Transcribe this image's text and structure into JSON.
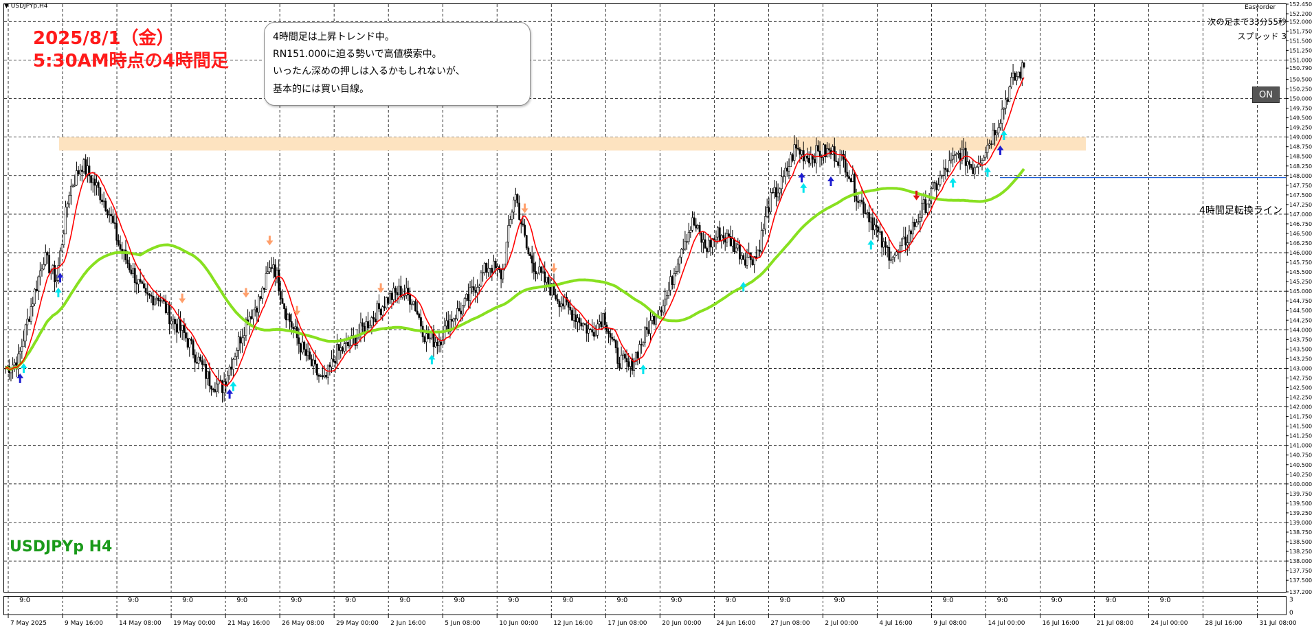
{
  "window": {
    "title": "USDJPYp,H4"
  },
  "annotations": {
    "date_title_line1": "2025/8/1（金）",
    "date_title_line2": "5:30AM時点の4時間足",
    "note_lines": [
      "4時間足は上昇トレンド中。",
      "RN151.000に迫る勢いで高値模索中。",
      "いったん深めの押しは入るかもしれないが、",
      "基本的には買い目線。"
    ],
    "timer_text": "次の足まで33分55秒",
    "spread_text": "スプレッド 3",
    "easyorder_label": "Easyorder",
    "on_button": "ON",
    "conversion_line_label": "4時間足転換ライン",
    "symbol_label": "USDJPYp H4"
  },
  "subwindow": {
    "top_value": "3",
    "bottom_value": "0",
    "tick_label": "9:0"
  },
  "colors": {
    "candle": "#000000",
    "fast_ma": "#ff0000",
    "slow_ma": "#88e020",
    "resistance_zone": "#fde3c0",
    "conversion_line": "#1f5fd6",
    "buy_arrow": "#00e5ee",
    "sell_arrow": "#ff9f6b",
    "major_buy_arrow": "#1e1ed0",
    "major_sell_arrow": "#dd1111"
  },
  "chart_data": {
    "type": "candlestick",
    "symbol": "USDJPYp",
    "timeframe": "H4",
    "ylim": [
      137.2,
      152.45
    ],
    "price_ticks": [
      "152.450",
      "152.200",
      "152.000",
      "151.750",
      "151.500",
      "151.250",
      "151.000",
      "150.790",
      "150.500",
      "150.250",
      "150.000",
      "149.750",
      "149.500",
      "149.250",
      "149.000",
      "148.750",
      "148.500",
      "148.250",
      "148.000",
      "147.750",
      "147.500",
      "147.250",
      "147.000",
      "146.750",
      "146.500",
      "146.250",
      "146.000",
      "145.750",
      "145.500",
      "145.250",
      "145.000",
      "144.750",
      "144.500",
      "144.250",
      "144.000",
      "143.750",
      "143.500",
      "143.250",
      "143.000",
      "142.750",
      "142.500",
      "142.250",
      "142.000",
      "141.750",
      "141.500",
      "141.250",
      "141.000",
      "140.750",
      "140.500",
      "140.250",
      "140.000",
      "139.750",
      "139.500",
      "139.250",
      "139.000",
      "138.750",
      "138.500",
      "138.250",
      "138.000",
      "137.750",
      "137.500",
      "137.200"
    ],
    "date_labels": [
      "7 May 2025",
      "9 May 16:00",
      "14 May 08:00",
      "19 May 00:00",
      "21 May 16:00",
      "26 May 08:00",
      "29 May 00:00",
      "2 Jun 16:00",
      "5 Jun 08:00",
      "10 Jun 00:00",
      "12 Jun 16:00",
      "17 Jun 08:00",
      "20 Jun 00:00",
      "24 Jun 16:00",
      "27 Jun 08:00",
      "2 Jul 00:00",
      "4 Jul 16:00",
      "9 Jul 08:00",
      "14 Jul 00:00",
      "16 Jul 16:00",
      "21 Jul 08:00",
      "24 Jul 00:00",
      "28 Jul 16:00",
      "31 Jul 08:00"
    ],
    "close_path": [
      143.0,
      143.2,
      144.6,
      145.9,
      145.3,
      147.6,
      148.3,
      147.8,
      147.2,
      146.1,
      145.5,
      144.8,
      144.9,
      144.3,
      143.9,
      143.3,
      142.7,
      142.5,
      143.4,
      144.3,
      144.8,
      145.8,
      144.5,
      143.7,
      143.1,
      142.6,
      143.4,
      143.6,
      144.0,
      144.4,
      144.8,
      145.0,
      144.8,
      143.8,
      143.7,
      144.3,
      144.6,
      145.2,
      145.7,
      145.4,
      147.6,
      146.0,
      145.4,
      145.0,
      144.6,
      144.3,
      143.9,
      144.4,
      143.3,
      143.0,
      143.7,
      144.4,
      144.9,
      146.1,
      146.8,
      146.1,
      146.5,
      146.3,
      145.9,
      145.9,
      147.3,
      147.8,
      148.7,
      148.5,
      148.6,
      148.6,
      148.3,
      147.4,
      146.9,
      146.1,
      145.9,
      146.5,
      147.1,
      147.7,
      148.2,
      148.6,
      148.2,
      148.7,
      149.4,
      150.4,
      150.8
    ],
    "resistance_zone": [
      148.65,
      149.0
    ],
    "conversion_line_price": 147.95,
    "subwindow_range": [
      0,
      3
    ]
  }
}
